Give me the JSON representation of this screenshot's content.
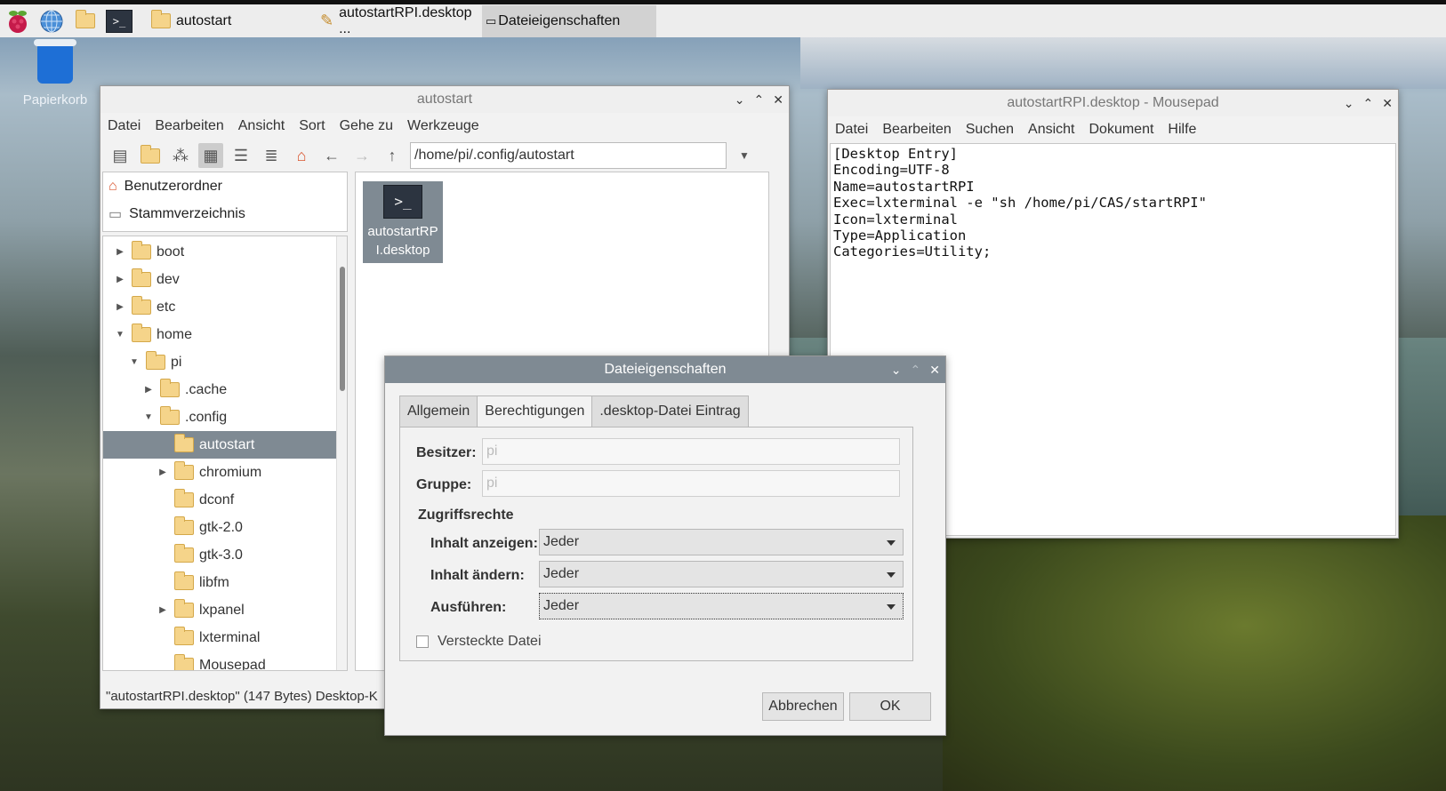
{
  "taskbar": {
    "items": [
      {
        "label": "autostart"
      },
      {
        "label": "autostartRPI.desktop ..."
      },
      {
        "label": "Dateieigenschaften"
      }
    ]
  },
  "desktop": {
    "trash_label": "Papierkorb"
  },
  "filemanager": {
    "title": "autostart",
    "menu": [
      "Datei",
      "Bearbeiten",
      "Ansicht",
      "Sort",
      "Gehe zu",
      "Werkzeuge"
    ],
    "address": "/home/pi/.config/autostart",
    "places": [
      "Benutzerordner",
      "Stammverzeichnis"
    ],
    "tree": [
      {
        "label": "boot",
        "depth": 0,
        "arrow": "right"
      },
      {
        "label": "dev",
        "depth": 0,
        "arrow": "right"
      },
      {
        "label": "etc",
        "depth": 0,
        "arrow": "right"
      },
      {
        "label": "home",
        "depth": 0,
        "arrow": "down"
      },
      {
        "label": "pi",
        "depth": 1,
        "arrow": "down",
        "home": true
      },
      {
        "label": ".cache",
        "depth": 2,
        "arrow": "right"
      },
      {
        "label": ".config",
        "depth": 2,
        "arrow": "down"
      },
      {
        "label": "autostart",
        "depth": 3,
        "arrow": "",
        "selected": true
      },
      {
        "label": "chromium",
        "depth": 3,
        "arrow": "right"
      },
      {
        "label": "dconf",
        "depth": 3,
        "arrow": ""
      },
      {
        "label": "gtk-2.0",
        "depth": 3,
        "arrow": ""
      },
      {
        "label": "gtk-3.0",
        "depth": 3,
        "arrow": ""
      },
      {
        "label": "libfm",
        "depth": 3,
        "arrow": ""
      },
      {
        "label": "lxpanel",
        "depth": 3,
        "arrow": "right"
      },
      {
        "label": "lxterminal",
        "depth": 3,
        "arrow": ""
      },
      {
        "label": "Mousepad",
        "depth": 3,
        "arrow": ""
      }
    ],
    "file_name": "autostartRP\nI.desktop",
    "status": "\"autostartRPI.desktop\" (147 Bytes) Desktop-K"
  },
  "mousepad": {
    "title": "autostartRPI.desktop - Mousepad",
    "menu": [
      "Datei",
      "Bearbeiten",
      "Suchen",
      "Ansicht",
      "Dokument",
      "Hilfe"
    ],
    "content": "[Desktop Entry]\nEncoding=UTF-8\nName=autostartRPI\nExec=lxterminal -e \"sh /home/pi/CAS/startRPI\"\nIcon=lxterminal\nType=Application\nCategories=Utility;"
  },
  "dialog": {
    "title": "Dateieigenschaften",
    "tabs": [
      "Allgemein",
      "Berechtigungen",
      ".desktop-Datei Eintrag"
    ],
    "owner_label": "Besitzer:",
    "owner_value": "pi",
    "group_label": "Gruppe:",
    "group_value": "pi",
    "section": "Zugriffsrechte",
    "view_label": "Inhalt anzeigen:",
    "view_value": "Jeder",
    "edit_label": "Inhalt ändern:",
    "edit_value": "Jeder",
    "exec_label": "Ausführen:",
    "exec_value": "Jeder",
    "hidden_label": "Versteckte Datei",
    "cancel": "Abbrechen",
    "ok": "OK"
  }
}
